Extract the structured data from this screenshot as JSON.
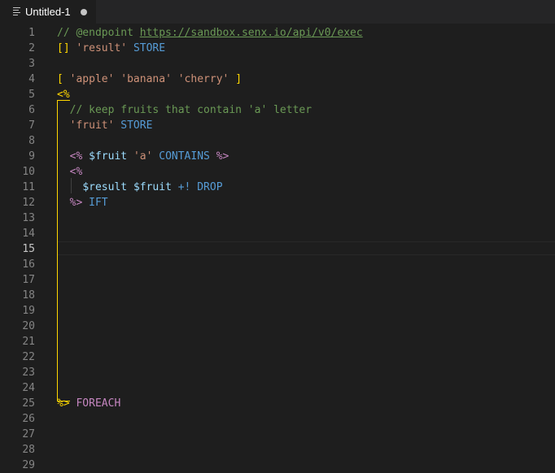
{
  "tab": {
    "title": "Untitled-1",
    "icon": "file-lines-icon",
    "dirty": true
  },
  "editor": {
    "active_line": 15,
    "lines": [
      {
        "n": "1",
        "tokens": [
          {
            "t": "// @endpoint ",
            "c": "comment"
          },
          {
            "t": "https://sandbox.senx.io/api/v0/exec",
            "c": "link"
          }
        ]
      },
      {
        "n": "2",
        "tokens": [
          {
            "t": "[]",
            "c": "bracket"
          },
          {
            "t": " ",
            "c": "plain"
          },
          {
            "t": "'result'",
            "c": "string"
          },
          {
            "t": " ",
            "c": "plain"
          },
          {
            "t": "STORE",
            "c": "keyword"
          }
        ]
      },
      {
        "n": "3",
        "tokens": []
      },
      {
        "n": "4",
        "tokens": [
          {
            "t": "[",
            "c": "bracket"
          },
          {
            "t": " ",
            "c": "plain"
          },
          {
            "t": "'apple'",
            "c": "string"
          },
          {
            "t": " ",
            "c": "plain"
          },
          {
            "t": "'banana'",
            "c": "string"
          },
          {
            "t": " ",
            "c": "plain"
          },
          {
            "t": "'cherry'",
            "c": "string"
          },
          {
            "t": " ",
            "c": "plain"
          },
          {
            "t": "]",
            "c": "bracket"
          }
        ]
      },
      {
        "n": "5",
        "tokens": [
          {
            "t": "<%",
            "c": "bracket"
          }
        ]
      },
      {
        "n": "6",
        "tokens": [
          {
            "t": "  // keep fruits that contain 'a' letter",
            "c": "comment"
          }
        ]
      },
      {
        "n": "7",
        "tokens": [
          {
            "t": "  ",
            "c": "plain"
          },
          {
            "t": "'fruit'",
            "c": "string"
          },
          {
            "t": " ",
            "c": "plain"
          },
          {
            "t": "STORE",
            "c": "keyword"
          }
        ]
      },
      {
        "n": "8",
        "tokens": []
      },
      {
        "n": "9",
        "tokens": [
          {
            "t": "  ",
            "c": "plain"
          },
          {
            "t": "<%",
            "c": "macro"
          },
          {
            "t": " ",
            "c": "plain"
          },
          {
            "t": "$fruit",
            "c": "var"
          },
          {
            "t": " ",
            "c": "plain"
          },
          {
            "t": "'a'",
            "c": "string"
          },
          {
            "t": " ",
            "c": "plain"
          },
          {
            "t": "CONTAINS",
            "c": "keyword"
          },
          {
            "t": " ",
            "c": "plain"
          },
          {
            "t": "%>",
            "c": "macro"
          }
        ]
      },
      {
        "n": "10",
        "tokens": [
          {
            "t": "  ",
            "c": "plain"
          },
          {
            "t": "<%",
            "c": "macro"
          }
        ]
      },
      {
        "n": "11",
        "tokens": [
          {
            "t": "    ",
            "c": "plain"
          },
          {
            "t": "$result",
            "c": "var"
          },
          {
            "t": " ",
            "c": "plain"
          },
          {
            "t": "$fruit",
            "c": "var"
          },
          {
            "t": " ",
            "c": "plain"
          },
          {
            "t": "+!",
            "c": "keyword"
          },
          {
            "t": " ",
            "c": "plain"
          },
          {
            "t": "DROP",
            "c": "keyword"
          }
        ]
      },
      {
        "n": "12",
        "tokens": [
          {
            "t": "  ",
            "c": "plain"
          },
          {
            "t": "%>",
            "c": "macro"
          },
          {
            "t": " ",
            "c": "plain"
          },
          {
            "t": "IFT",
            "c": "keyword"
          }
        ]
      },
      {
        "n": "13",
        "tokens": []
      },
      {
        "n": "14",
        "tokens": []
      },
      {
        "n": "15",
        "tokens": []
      },
      {
        "n": "16",
        "tokens": []
      },
      {
        "n": "17",
        "tokens": []
      },
      {
        "n": "18",
        "tokens": []
      },
      {
        "n": "19",
        "tokens": []
      },
      {
        "n": "20",
        "tokens": []
      },
      {
        "n": "21",
        "tokens": []
      },
      {
        "n": "22",
        "tokens": []
      },
      {
        "n": "23",
        "tokens": []
      },
      {
        "n": "24",
        "tokens": []
      },
      {
        "n": "25",
        "tokens": [
          {
            "t": "%>",
            "c": "bracket"
          },
          {
            "t": " ",
            "c": "plain"
          },
          {
            "t": "FOREACH",
            "c": "macro"
          }
        ]
      },
      {
        "n": "26",
        "tokens": []
      },
      {
        "n": "27",
        "tokens": []
      },
      {
        "n": "28",
        "tokens": []
      },
      {
        "n": "29",
        "tokens": []
      }
    ]
  },
  "colors": {
    "background": "#1e1e1e",
    "comment": "#6a9955",
    "string": "#ce9178",
    "keyword": "#569cd6",
    "macro": "#c586c0",
    "variable": "#9cdcfe",
    "bracket": "#ffd700"
  }
}
